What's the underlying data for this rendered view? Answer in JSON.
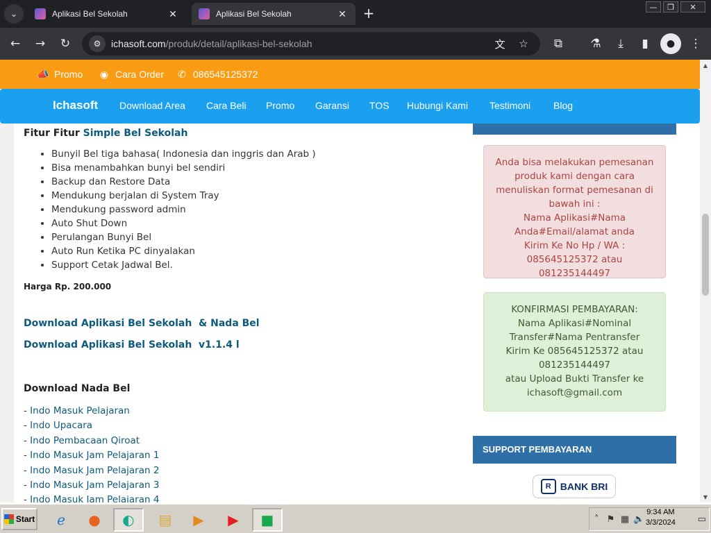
{
  "browser": {
    "tabs": [
      {
        "title": "Aplikasi Bel Sekolah",
        "active": false
      },
      {
        "title": "Aplikasi Bel Sekolah",
        "active": true
      }
    ],
    "url_domain": "ichasoft.com",
    "url_path": "/produk/detail/aplikasi-bel-sekolah",
    "new_tab_symbol": "+",
    "close_symbol": "✕"
  },
  "topbar": {
    "promo": "Promo",
    "cara_order": "Cara Order",
    "phone": "086545125372"
  },
  "navbar": {
    "brand": "Ichasoft",
    "links": [
      "Download Area",
      "Cara Beli",
      "Promo",
      "Garansi",
      "TOS",
      "Hubungi Kami",
      "Testimoni",
      "Blog"
    ]
  },
  "main": {
    "feature_title_prefix": "Fitur Fitur ",
    "feature_title_link": "Simple Bel Sekolah",
    "features": [
      "Bunyil Bel tiga bahasa( Indonesia dan inggris dan Arab )",
      "Bisa menambahkan bunyi bel sendiri",
      "Backup dan Restore Data",
      "Mendukung berjalan di System Tray",
      "Mendukung password admin",
      "Auto Shut Down",
      "Perulangan Bunyi Bel",
      "Auto Run Ketika PC dinyalakan",
      "Support Cetak Jadwal Bel."
    ],
    "price": "Harga Rp. 200.000",
    "download_links": [
      "Download Aplikasi Bel Sekolah  & Nada Bel",
      "Download Aplikasi Bel Sekolah  v1.1.4 l"
    ],
    "nada_title": "Download Nada Bel",
    "nada_items": [
      "Indo Masuk Pelajaran",
      "Indo Upacara",
      "Indo Pembacaan Qiroat",
      "Indo Masuk Jam Pelajaran 1",
      "Indo Masuk Jam Pelajaran 2",
      "Indo Masuk Jam Pelajaran 3",
      "Indo Masuk Jam Pelajaran 4"
    ]
  },
  "sidebar": {
    "order_box": [
      "Anda bisa melakukan pemesanan produk kami dengan cara menuliskan format pemesanan di bawah ini :",
      "Nama Aplikasi#Nama Anda#Email/alamat anda",
      "Kirim Ke No Hp / WA : 085645125372 atau 081235144497"
    ],
    "confirm_box": [
      "KONFIRMASI PEMBAYARAN:",
      "Nama Aplikasi#Nominal Transfer#Nama Pentransfer",
      "Kirim Ke 085645125372 atau 081235144497",
      "atau Upload Bukti Transfer ke ichasoft@gmail.com"
    ],
    "support_title": "SUPPORT PEMBAYARAN",
    "bank": "BANK BRI"
  },
  "taskbar": {
    "start": "Start",
    "time": "9:34 AM",
    "date": "3/3/2024"
  }
}
